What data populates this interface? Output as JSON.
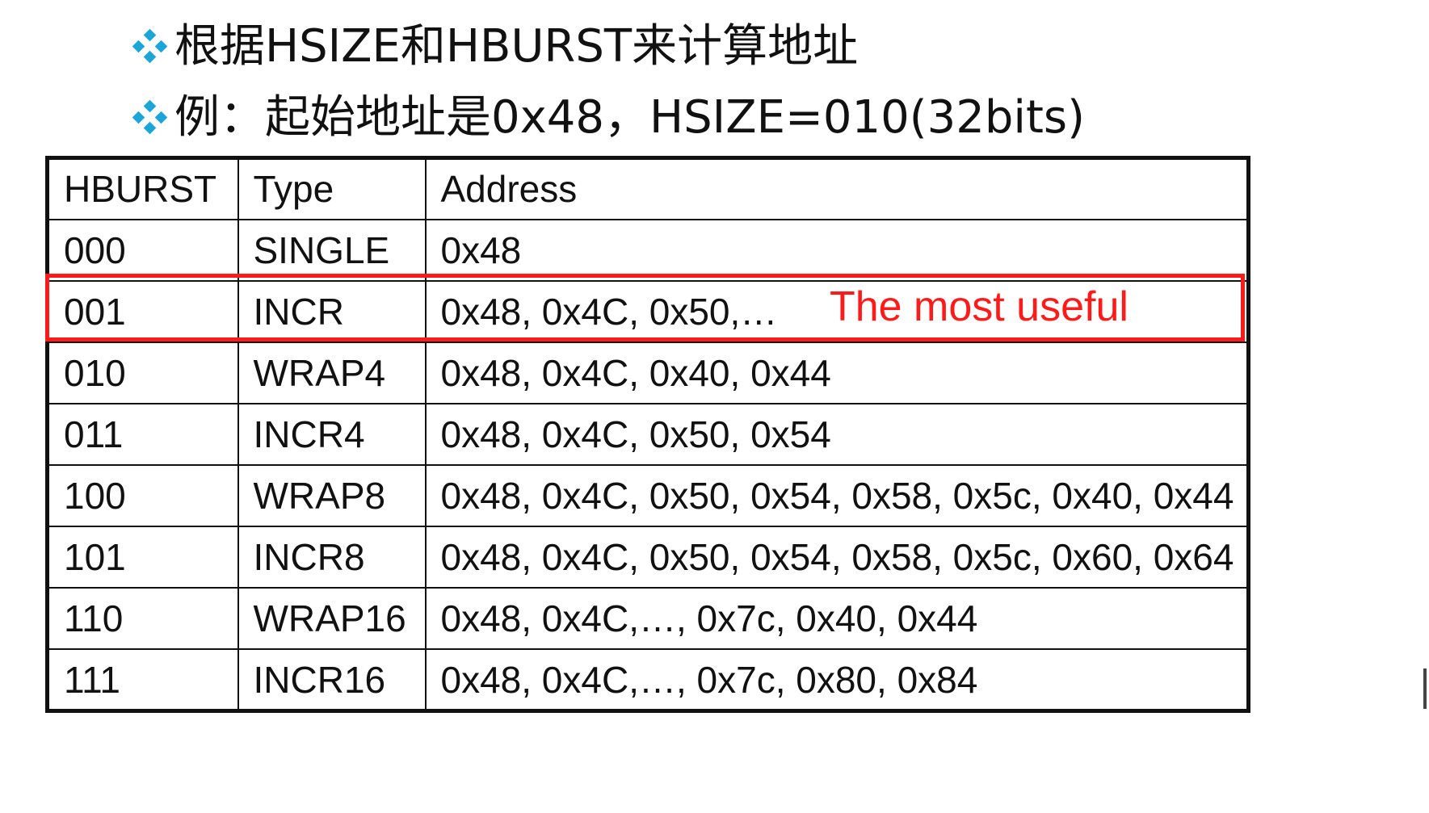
{
  "bullets": [
    {
      "icon": "diamond-bullet-icon",
      "text": "根据HSIZE和HBURST来计算地址"
    },
    {
      "icon": "diamond-bullet-icon",
      "text": "例：起始地址是0x48，HSIZE=010(32bits)"
    }
  ],
  "colors": {
    "bullet_icon": "#1ba6d8",
    "highlight": "#ff1a1a",
    "text": "#111111"
  },
  "table": {
    "headers": [
      "HBURST",
      "Type",
      "Address"
    ],
    "rows": [
      [
        "000",
        "SINGLE",
        "0x48"
      ],
      [
        "001",
        "INCR",
        "0x48, 0x4C, 0x50,…"
      ],
      [
        "010",
        "WRAP4",
        "0x48, 0x4C, 0x40, 0x44"
      ],
      [
        "011",
        "INCR4",
        "0x48, 0x4C, 0x50, 0x54"
      ],
      [
        "100",
        "WRAP8",
        "0x48, 0x4C, 0x50, 0x54, 0x58, 0x5c, 0x40, 0x44"
      ],
      [
        "101",
        "INCR8",
        "0x48, 0x4C, 0x50, 0x54, 0x58, 0x5c, 0x60, 0x64"
      ],
      [
        "110",
        "WRAP16",
        "0x48, 0x4C,…, 0x7c, 0x40, 0x44"
      ],
      [
        "111",
        "INCR16",
        "0x48, 0x4C,…, 0x7c, 0x80, 0x84"
      ]
    ],
    "highlighted_row_index": 1
  },
  "annotation": "The most useful"
}
